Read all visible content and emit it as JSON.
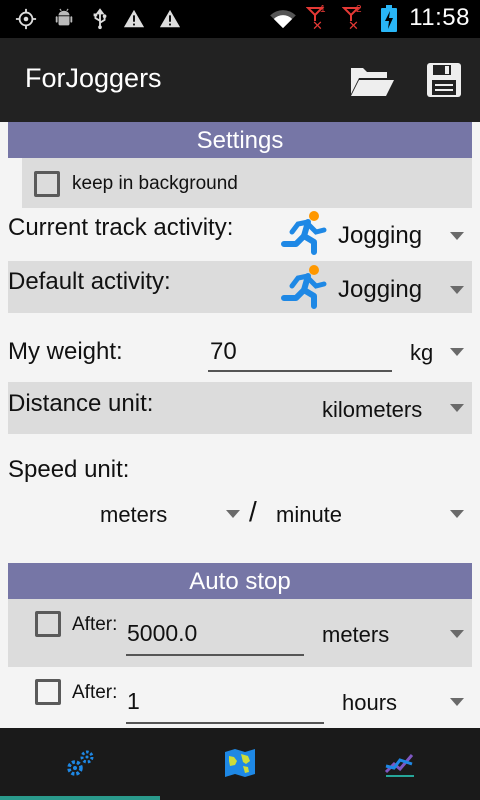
{
  "status_bar": {
    "time": "11:58",
    "icons": [
      "gps-icon",
      "android-debug-icon",
      "usb-icon",
      "warning-icon",
      "warning-icon",
      "wifi-icon",
      "sim1-no-signal-icon",
      "sim2-no-signal-icon",
      "battery-charging-icon"
    ],
    "sim1": "1",
    "sim2": "2"
  },
  "app_bar": {
    "title": "ForJoggers",
    "open_icon": "folder-open-icon",
    "save_icon": "save-icon"
  },
  "settings": {
    "header": "Settings",
    "keep_in_background": {
      "label": "keep in background",
      "checked": false
    },
    "current_track_activity": {
      "label": "Current track activity:",
      "value": "Jogging",
      "icon": "runner-icon"
    },
    "default_activity": {
      "label": "Default activity:",
      "value": "Jogging",
      "icon": "runner-icon"
    },
    "weight": {
      "label": "My weight:",
      "value": "70",
      "unit": "kg"
    },
    "distance_unit": {
      "label": "Distance unit:",
      "value": "kilometers"
    },
    "speed_unit": {
      "label": "Speed unit:",
      "numerator": "meters",
      "separator": "/",
      "denominator": "minute"
    }
  },
  "auto_stop": {
    "header": "Auto stop",
    "rules": [
      {
        "checked": false,
        "label": "After:",
        "value": "5000.0",
        "unit": "meters"
      },
      {
        "checked": false,
        "label": "After:",
        "value": "1",
        "unit": "hours"
      }
    ]
  },
  "bottom_nav": {
    "tabs": [
      {
        "icon": "settings-gears-icon",
        "active": true
      },
      {
        "icon": "map-icon",
        "active": false
      },
      {
        "icon": "chart-icon",
        "active": false
      }
    ]
  },
  "colors": {
    "section_header": "#7676a6",
    "app_bar": "#222222",
    "runner": "#1e88e5",
    "runner_head": "#ff9800",
    "nav_indicator": "#2a9a8c"
  }
}
